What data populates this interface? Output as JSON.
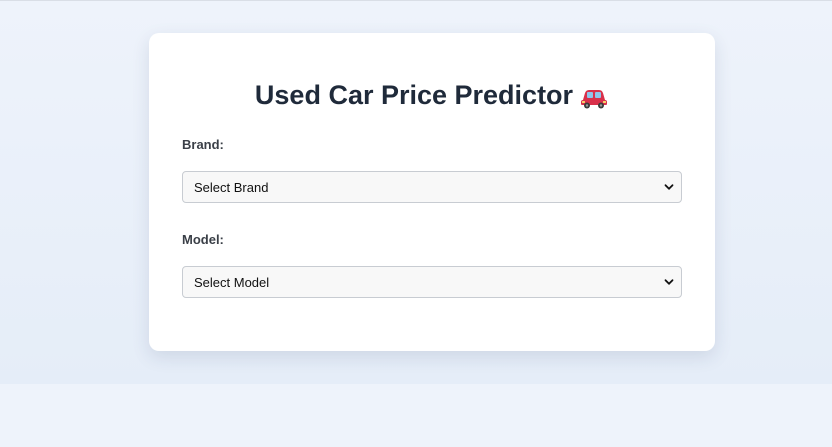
{
  "form": {
    "title": "Used Car Price Predictor",
    "title_icon": "car-icon",
    "brand_label": "Brand:",
    "brand_selected": "Select Brand",
    "model_label": "Model:",
    "model_selected": "Select Model"
  },
  "colors": {
    "background": "#eef3fb",
    "card": "#ffffff",
    "title_text": "#1f2a3a",
    "car_red": "#d9304a"
  }
}
